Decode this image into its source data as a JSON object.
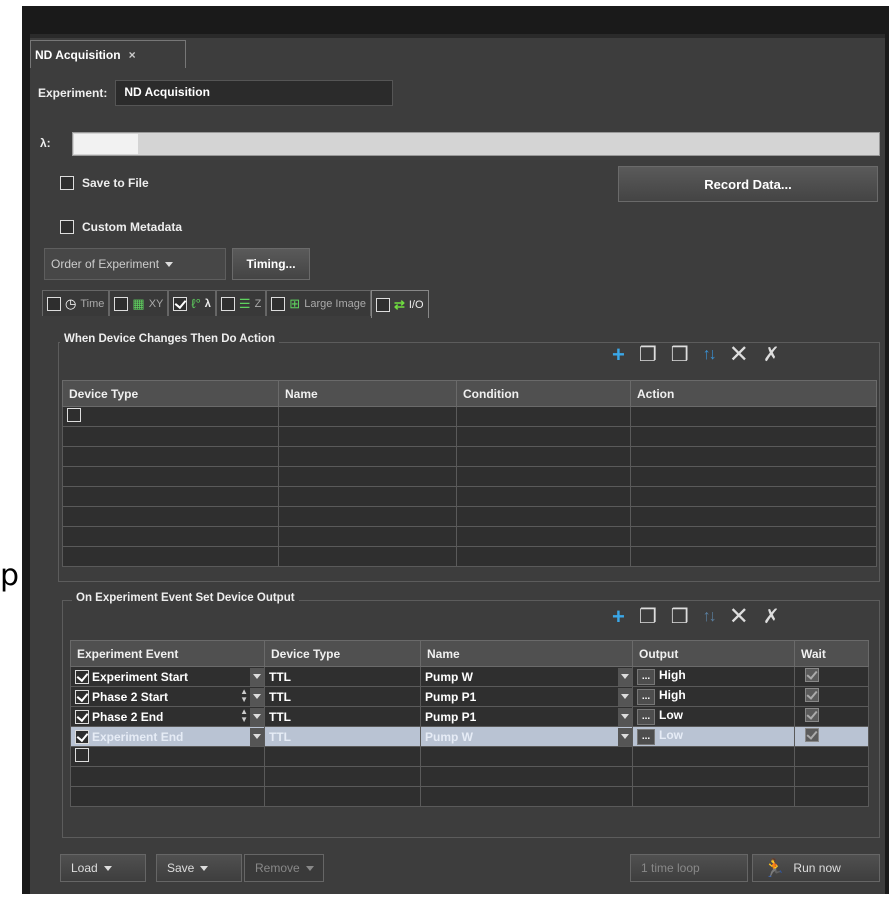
{
  "stray_letter": "p",
  "tab": {
    "title": "ND Acquisition",
    "close": "×"
  },
  "experiment": {
    "label": "Experiment:",
    "value": "ND Acquisition"
  },
  "lambda": {
    "label": "λ:"
  },
  "options": {
    "save_to_file": {
      "label": "Save to File",
      "checked": false
    },
    "custom_metadata": {
      "label": "Custom Metadata",
      "checked": false
    },
    "record_data_label": "Record Data...",
    "order_label": "Order of Experiment",
    "timing_label": "Timing..."
  },
  "nd_tabs": [
    {
      "label": "Time",
      "icon": "clock-icon",
      "checked": false
    },
    {
      "label": "XY",
      "icon": "grid-icon",
      "checked": false
    },
    {
      "label": "λ",
      "icon": "lambda-icon",
      "checked": true
    },
    {
      "label": "Z",
      "icon": "stack-icon",
      "checked": false
    },
    {
      "label": "Large Image",
      "icon": "large-image-icon",
      "checked": false
    },
    {
      "label": "I/O",
      "icon": "io-arrows-icon",
      "checked": false
    }
  ],
  "device_action": {
    "title": "When Device Changes Then Do Action",
    "columns": [
      "Device Type",
      "Name",
      "Condition",
      "Action"
    ]
  },
  "device_output": {
    "title": "On Experiment Event Set Device Output",
    "columns": [
      "Experiment Event",
      "Device Type",
      "Name",
      "Output",
      "Wait"
    ],
    "rows": [
      {
        "event": "Experiment Start",
        "device_type": "TTL",
        "name": "Pump W",
        "output": "High",
        "checked": true,
        "wait": true
      },
      {
        "event": "Phase 2 Start",
        "device_type": "TTL",
        "name": "Pump P1",
        "output": "High",
        "checked": true,
        "wait": true
      },
      {
        "event": "Phase 2 End",
        "device_type": "TTL",
        "name": "Pump P1",
        "output": "Low",
        "checked": true,
        "wait": true
      },
      {
        "event": "Experiment End",
        "device_type": "TTL",
        "name": "Pump W",
        "output": "Low",
        "checked": true,
        "wait": true
      }
    ]
  },
  "bottom": {
    "load_label": "Load",
    "save_label": "Save",
    "remove_label": "Remove",
    "loop_label": "1 time loop",
    "run_label": "Run now"
  },
  "colors": {
    "accent": "#3aa7e8",
    "panel": "#3d3d3d",
    "selected_row": "#b9c3d3"
  }
}
